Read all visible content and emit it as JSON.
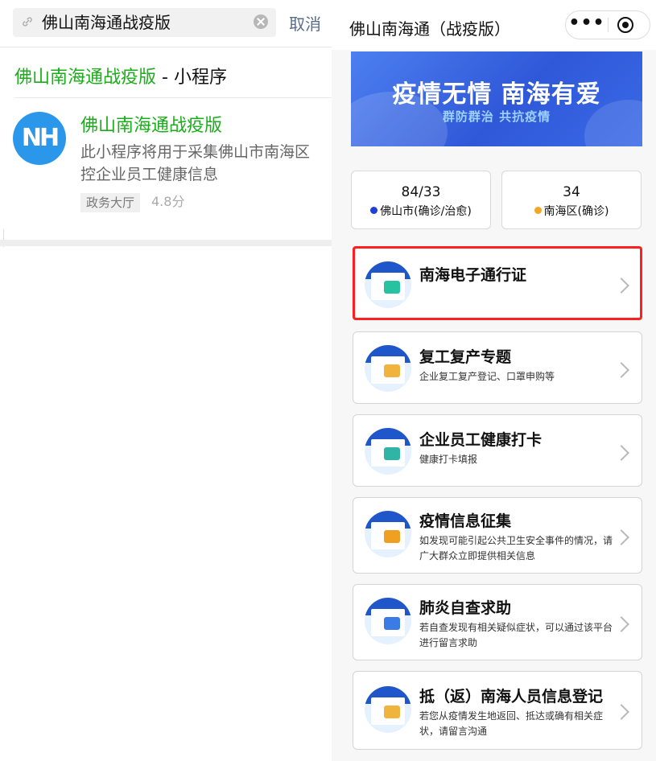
{
  "left": {
    "search": {
      "value": "佛山南海通战疫版",
      "cancel_label": "取消"
    },
    "result_header": {
      "highlight": "佛山南海通战疫版",
      "rest": " - 小程序"
    },
    "app": {
      "logo_text": "NH",
      "name": "佛山南海通战疫版",
      "description": "此小程序将用于采集佛山市南海区控企业员工健康信息",
      "category": "政务大厅",
      "score": "4.8分"
    }
  },
  "right": {
    "nav_title": "佛山南海通（战疫版）",
    "capsule_menu": "•••",
    "banner": {
      "title": "疫情无情 南海有爱",
      "subtitle": "群防群治 共抗疫情"
    },
    "stats": [
      {
        "value": "84/33",
        "label": "佛山市(确诊/治愈)",
        "dot_color": "#1f3fd8"
      },
      {
        "value": "34",
        "label": "南海区(确诊)",
        "dot_color": "#f5a623"
      }
    ],
    "cards": [
      {
        "title": "南海电子通行证",
        "desc": ""
      },
      {
        "title": "复工复产专题",
        "desc": "企业复工复产登记、口罩申购等"
      },
      {
        "title": "企业员工健康打卡",
        "desc": "健康打卡填报"
      },
      {
        "title": "疫情信息征集",
        "desc": "如发现可能引起公共卫生安全事件的情况，请广大群众立即提供相关信息"
      },
      {
        "title": "肺炎自查求助",
        "desc": "若自查发现有相关疑似症状，可以通过该平台进行留言求助"
      },
      {
        "title": "抵（返）南海人员信息登记",
        "desc": "若您从疫情发生地返回、抵达或确有相关症状，请留言沟通"
      }
    ]
  },
  "colors": {
    "wechat_green": "#1aad19",
    "highlight_red": "#ff1f1f",
    "banner_blue": "#2f58d8"
  }
}
